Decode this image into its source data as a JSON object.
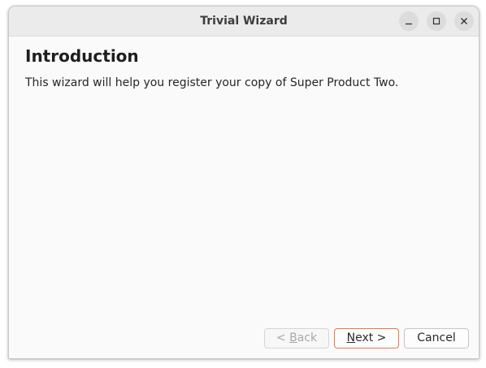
{
  "window": {
    "title": "Trivial Wizard",
    "controls": [
      "minimize-icon",
      "maximize-icon",
      "close-icon"
    ]
  },
  "page": {
    "title": "Introduction",
    "description": "This wizard will help you register your copy of Super Product Two."
  },
  "buttons": {
    "back": {
      "prefix": "< ",
      "mnemonic": "B",
      "rest": "ack",
      "enabled": false
    },
    "next": {
      "mnemonic": "N",
      "rest": "ext >",
      "enabled": true
    },
    "cancel": {
      "label": "Cancel",
      "enabled": true
    }
  },
  "colors": {
    "default_button_border": "#e8774f",
    "titlebar": "#ebebeb",
    "disabled_text": "#a8a8a8"
  }
}
